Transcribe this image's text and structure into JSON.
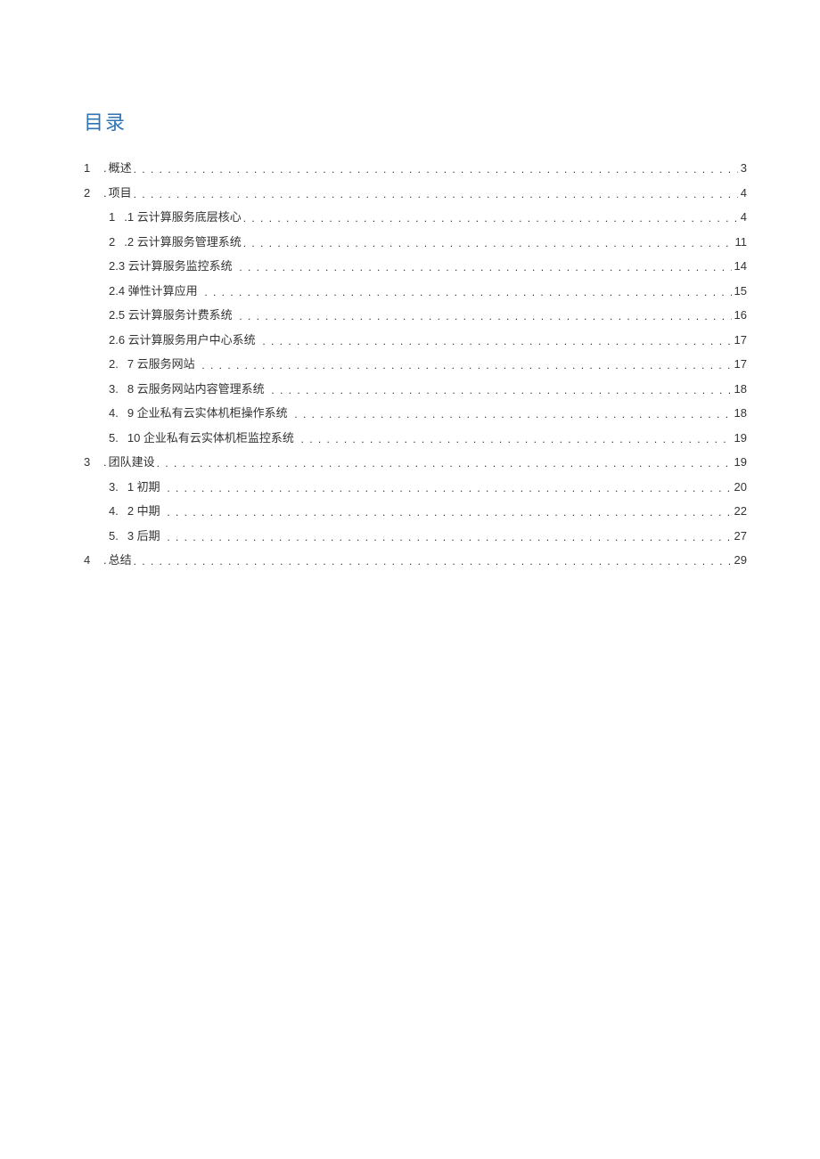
{
  "title": "目录",
  "toc": {
    "level1": [
      {
        "num": "1",
        "dot": ".",
        "label": "概述",
        "page": "3"
      },
      {
        "num": "2",
        "dot": ".",
        "label": "项目",
        "page": "4"
      },
      {
        "num": "3",
        "dot": ".",
        "label": "团队建设",
        "page": "19"
      },
      {
        "num": "4",
        "dot": ".",
        "label": "总结",
        "page": "29"
      }
    ],
    "sec2": [
      {
        "pre": "1",
        "label": ".1 云计算服务底层核心",
        "page": "4"
      },
      {
        "pre": "2",
        "label": ".2 云计算服务管理系统",
        "page": "11"
      },
      {
        "pre": "",
        "label": "2.3 云计算服务监控系统",
        "page": "14"
      },
      {
        "pre": "",
        "label": "2.4 弹性计算应用",
        "page": "15"
      },
      {
        "pre": "",
        "label": "2.5 云计算服务计费系统",
        "page": "16"
      },
      {
        "pre": "",
        "label": "2.6 云计算服务用户中心系统",
        "page": "17"
      },
      {
        "pre": "2.",
        "label": "7 云服务网站",
        "page": "17"
      },
      {
        "pre": "3.",
        "label": "8 云服务网站内容管理系统",
        "page": "18"
      },
      {
        "pre": "4.",
        "label": "9 企业私有云实体机柜操作系统",
        "page": "18"
      },
      {
        "pre": "5.",
        "label": "10 企业私有云实体机柜监控系统",
        "page": "19"
      }
    ],
    "sec3": [
      {
        "pre": "3.",
        "label": "1 初期",
        "page": "20"
      },
      {
        "pre": "4.",
        "label": "2 中期",
        "page": "22"
      },
      {
        "pre": "5.",
        "label": "3 后期",
        "page": "27"
      }
    ]
  }
}
